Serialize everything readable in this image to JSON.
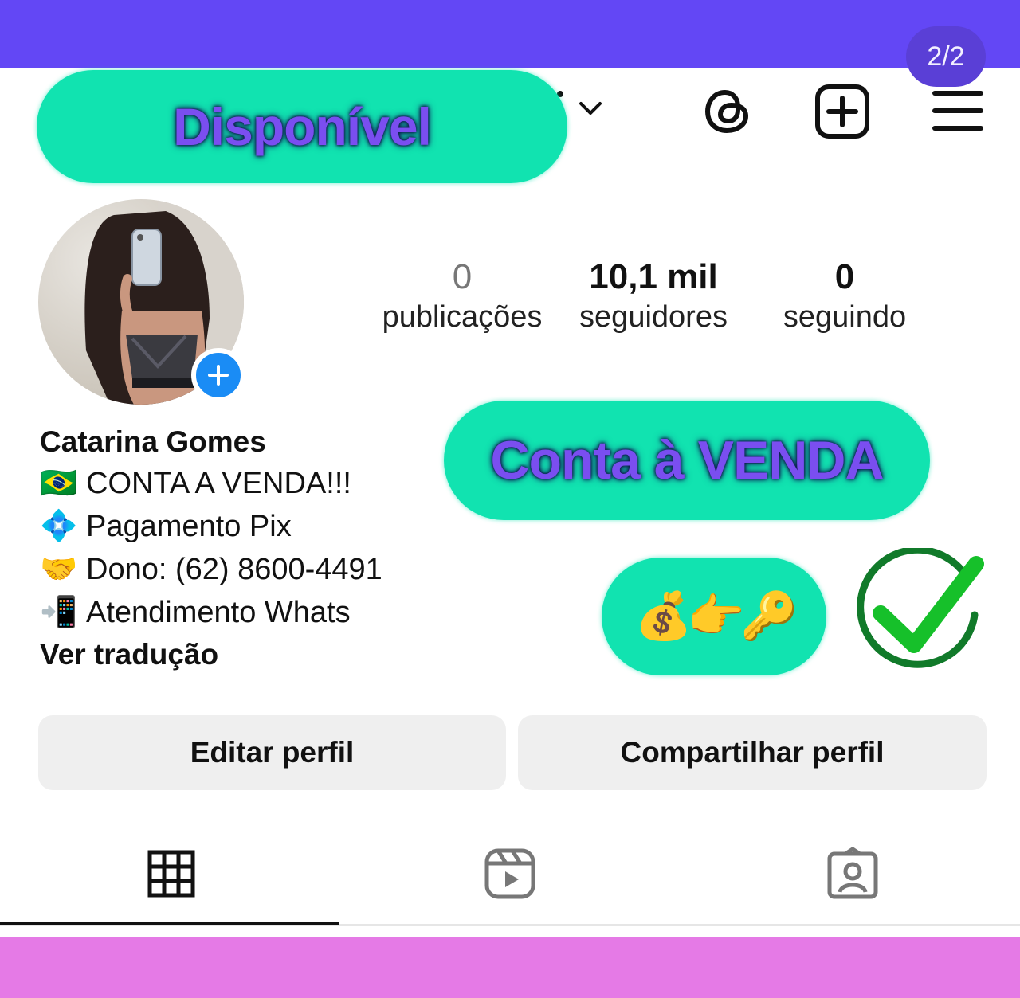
{
  "banner": {
    "page_counter": "2/2",
    "available_label": "Disponível"
  },
  "header_icons": [
    "chevron-down-icon",
    "threads-icon",
    "new-post-icon",
    "menu-icon"
  ],
  "profile": {
    "stats": [
      {
        "value": "0",
        "label": "publicações"
      },
      {
        "value": "10,1 mil",
        "label": "seguidores"
      },
      {
        "value": "0",
        "label": "seguindo"
      }
    ],
    "name": "Catarina Gomes",
    "bio": [
      {
        "emoji": "🇧🇷",
        "text": "CONTA A VENDA!!!"
      },
      {
        "emoji": "💠",
        "text": "Pagamento Pix"
      },
      {
        "emoji": "🤝",
        "text": "Dono: (62) 8600-4491"
      },
      {
        "emoji": "📲",
        "text": "Atendimento Whats"
      }
    ],
    "translate_label": "Ver tradução"
  },
  "overlay": {
    "sale_label": "Conta à VENDA",
    "emoji_strip": "💰👉🔑"
  },
  "actions": {
    "edit_label": "Editar perfil",
    "share_label": "Compartilhar perfil"
  },
  "tabs": [
    "grid-icon",
    "reels-icon",
    "tagged-icon"
  ],
  "colors": {
    "top_band": "#6347f5",
    "bottom_band": "#e57ae6",
    "pill": "#11e3b0",
    "pill_text": "#7a4ef0",
    "check": "#16c02a",
    "check_ring": "#117a2a"
  }
}
